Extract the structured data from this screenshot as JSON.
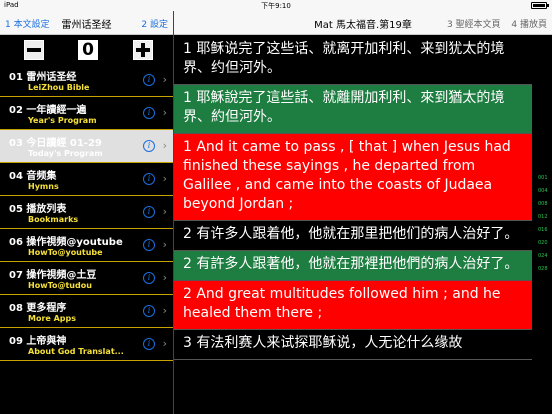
{
  "status": {
    "carrier": "iPad",
    "time": "下午9:10",
    "battery_pct": ""
  },
  "left_nav": {
    "left_btn": "1 本文設定",
    "title": "雷州话圣经",
    "right_btn": "2 設定"
  },
  "right_nav": {
    "title": "Mat 馬太福音.第19章",
    "btn1": "3 聖經本文頁",
    "btn2": "4 播放頁"
  },
  "toolbar": {
    "zero": "0"
  },
  "menu": [
    {
      "label": "01 雷州话圣经",
      "sub": "LeiZhou Bible"
    },
    {
      "label": "02 一年讀經一遍",
      "sub": "Year's Program"
    },
    {
      "label": "03 今日讀經 01-29",
      "sub": "Today's Program"
    },
    {
      "label": "04 音频集",
      "sub": "Hymns"
    },
    {
      "label": "05 播放列表",
      "sub": "Bookmarks"
    },
    {
      "label": "06 操作視頻@youtube",
      "sub": "HowTo@youtube"
    },
    {
      "label": "07 操作視頻@土豆",
      "sub": "HowTo@tudou"
    },
    {
      "label": "08 更多程序",
      "sub": "More Apps"
    },
    {
      "label": "09 上帝與神",
      "sub": "About God Translat..."
    }
  ],
  "verses": [
    {
      "kind": "zh-s",
      "text": "1 耶稣说完了这些话、就离开加利利、来到犹太的境界、约但河外。"
    },
    {
      "kind": "zh-t",
      "text": "1 耶穌說完了這些話、就離開加利利、來到猶太的境界、約但河外。"
    },
    {
      "kind": "en",
      "text": "1 And it came to pass , [ that ] when Jesus had finished these sayings , he departed from Galilee , and came into the coasts of Judaea beyond Jordan ;"
    },
    {
      "kind": "zh-s",
      "text": "2 有许多人跟着他，他就在那里把他们的病人治好了。"
    },
    {
      "kind": "zh-t",
      "text": "2 有許多人跟著他，他就在那裡把他們的病人治好了。"
    },
    {
      "kind": "en",
      "text": "2 And great multitudes followed him ; and he healed them there ;"
    },
    {
      "kind": "zh-s",
      "text": "3 有法利赛人来试探耶稣说，人无论什么缘故"
    }
  ],
  "index_strip": [
    "001",
    "004",
    "008",
    "012",
    "016",
    "020",
    "024",
    "028"
  ],
  "colors": {
    "accent": "#1a6fe0",
    "zh_t_bg": "#1e7d40",
    "en_bg": "#ff0000",
    "sub_text": "#f5e03a",
    "index": "#29c34a"
  }
}
